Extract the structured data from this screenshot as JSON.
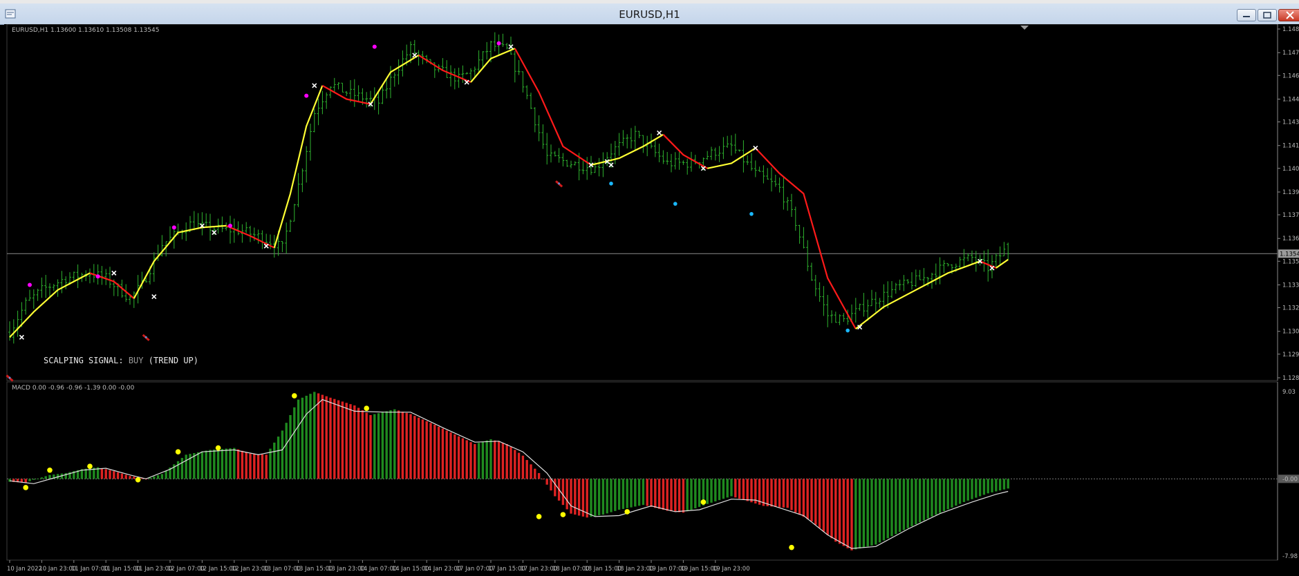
{
  "window": {
    "title": "EURUSD,H1",
    "controls": [
      "minimize",
      "restore",
      "close"
    ]
  },
  "main_info": "EURUSD,H1  1.13600 1.13610 1.13508 1.13545",
  "signal": {
    "prefix": "SCALPING SIGNAL:",
    "value": "BUY",
    "suffix": "(TREND UP)"
  },
  "macd_info": "MACD 0.00 -0.96 -0.96 -1.39 0.00 -0.00",
  "colors": {
    "background": "#000000",
    "candle": "#2fb52f",
    "ma_up": "#ffff33",
    "ma_down": "#ff1a1a",
    "hist_up": "#1f8a1f",
    "hist_down": "#dd2222",
    "macd_signal": "#e0e0e0",
    "macd_marker": "#ffff00",
    "swing_marker": "#ffffff",
    "buy_arrow": "#ff00ff",
    "dot_marker": "#1ab8ff",
    "current_price_bg": "#9b9b9b"
  },
  "chart_data": [
    {
      "type": "candlestick",
      "symbol": "EURUSD",
      "timeframe": "H1",
      "last_bar": {
        "open": 1.136,
        "high": 1.1361,
        "low": 1.13508,
        "close": 1.13545
      },
      "current_price_label": "1.13545",
      "y_ticks": [
        "1.14875",
        "1.14735",
        "1.14600",
        "1.14460",
        "1.14325",
        "1.14185",
        "1.14050",
        "1.13910",
        "1.13775",
        "1.13635",
        "1.13500",
        "1.13360",
        "1.13225",
        "1.13085",
        "1.12950",
        "1.12810"
      ],
      "ylim": [
        1.1281,
        1.14875
      ],
      "x_ticks": [
        "10 Jan 2022",
        "10 Jan 23:00",
        "11 Jan 07:00",
        "11 Jan 15:00",
        "11 Jan 23:00",
        "12 Jan 07:00",
        "12 Jan 15:00",
        "12 Jan 23:00",
        "13 Jan 07:00",
        "13 Jan 15:00",
        "13 Jan 23:00",
        "14 Jan 07:00",
        "14 Jan 15:00",
        "14 Jan 23:00",
        "17 Jan 07:00",
        "17 Jan 15:00",
        "17 Jan 23:00",
        "18 Jan 07:00",
        "18 Jan 15:00",
        "18 Jan 23:00",
        "19 Jan 07:00",
        "19 Jan 15:00",
        "19 Jan 23:00"
      ],
      "close_path": [
        [
          0,
          1.1308
        ],
        [
          4,
          1.1325
        ],
        [
          8,
          1.1333
        ],
        [
          14,
          1.134
        ],
        [
          20,
          1.1343
        ],
        [
          24,
          1.134
        ],
        [
          30,
          1.1328
        ],
        [
          33,
          1.1336
        ],
        [
          38,
          1.136
        ],
        [
          45,
          1.1372
        ],
        [
          52,
          1.1369
        ],
        [
          58,
          1.1368
        ],
        [
          64,
          1.1363
        ],
        [
          68,
          1.1358
        ],
        [
          72,
          1.1395
        ],
        [
          76,
          1.1438
        ],
        [
          80,
          1.1455
        ],
        [
          84,
          1.145
        ],
        [
          92,
          1.1444
        ],
        [
          96,
          1.1462
        ],
        [
          100,
          1.1476
        ],
        [
          105,
          1.1465
        ],
        [
          112,
          1.1458
        ],
        [
          115,
          1.1462
        ],
        [
          120,
          1.1478
        ],
        [
          124,
          1.1475
        ],
        [
          128,
          1.1455
        ],
        [
          134,
          1.1412
        ],
        [
          140,
          1.1408
        ],
        [
          146,
          1.1405
        ],
        [
          150,
          1.1415
        ],
        [
          156,
          1.1425
        ],
        [
          158,
          1.142
        ],
        [
          164,
          1.1408
        ],
        [
          170,
          1.1408
        ],
        [
          176,
          1.1415
        ],
        [
          180,
          1.1418
        ],
        [
          186,
          1.1402
        ],
        [
          192,
          1.1393
        ],
        [
          196,
          1.1373
        ],
        [
          200,
          1.134
        ],
        [
          204,
          1.1318
        ],
        [
          208,
          1.1315
        ],
        [
          214,
          1.1325
        ],
        [
          222,
          1.1335
        ],
        [
          228,
          1.134
        ],
        [
          234,
          1.1348
        ],
        [
          240,
          1.1352
        ],
        [
          244,
          1.1346
        ],
        [
          248,
          1.1356
        ]
      ],
      "ma_segments": [
        {
          "trend": "up",
          "points": [
            [
              0,
              1.1305
            ],
            [
              6,
              1.132
            ],
            [
              12,
              1.1333
            ],
            [
              20,
              1.1343
            ]
          ]
        },
        {
          "trend": "down",
          "points": [
            [
              20,
              1.1343
            ],
            [
              26,
              1.1338
            ],
            [
              31,
              1.1328
            ]
          ]
        },
        {
          "trend": "up",
          "points": [
            [
              31,
              1.1328
            ],
            [
              36,
              1.135
            ],
            [
              42,
              1.1367
            ],
            [
              48,
              1.137
            ],
            [
              54,
              1.1371
            ]
          ]
        },
        {
          "trend": "down",
          "points": [
            [
              54,
              1.1371
            ],
            [
              60,
              1.1365
            ],
            [
              66,
              1.1358
            ]
          ]
        },
        {
          "trend": "up",
          "points": [
            [
              66,
              1.1358
            ],
            [
              70,
              1.139
            ],
            [
              74,
              1.143
            ],
            [
              78,
              1.1454
            ]
          ]
        },
        {
          "trend": "down",
          "points": [
            [
              78,
              1.1454
            ],
            [
              84,
              1.1446
            ],
            [
              90,
              1.1443
            ]
          ]
        },
        {
          "trend": "up",
          "points": [
            [
              90,
              1.1443
            ],
            [
              95,
              1.1462
            ],
            [
              102,
              1.1472
            ]
          ]
        },
        {
          "trend": "down",
          "points": [
            [
              102,
              1.1472
            ],
            [
              108,
              1.1463
            ],
            [
              115,
              1.1456
            ]
          ]
        },
        {
          "trend": "up",
          "points": [
            [
              115,
              1.1456
            ],
            [
              120,
              1.147
            ],
            [
              126,
              1.1476
            ]
          ]
        },
        {
          "trend": "down",
          "points": [
            [
              126,
              1.1476
            ],
            [
              132,
              1.145
            ],
            [
              138,
              1.1418
            ],
            [
              145,
              1.1407
            ]
          ]
        },
        {
          "trend": "up",
          "points": [
            [
              145,
              1.1407
            ],
            [
              152,
              1.1411
            ],
            [
              158,
              1.1418
            ],
            [
              163,
              1.1425
            ]
          ]
        },
        {
          "trend": "down",
          "points": [
            [
              163,
              1.1425
            ],
            [
              168,
              1.1413
            ],
            [
              174,
              1.1405
            ]
          ]
        },
        {
          "trend": "up",
          "points": [
            [
              174,
              1.1405
            ],
            [
              180,
              1.1408
            ],
            [
              186,
              1.1417
            ]
          ]
        },
        {
          "trend": "down",
          "points": [
            [
              186,
              1.1417
            ],
            [
              192,
              1.1402
            ],
            [
              198,
              1.139
            ],
            [
              204,
              1.134
            ],
            [
              211,
              1.131
            ]
          ]
        },
        {
          "trend": "up",
          "points": [
            [
              211,
              1.131
            ],
            [
              218,
              1.1323
            ],
            [
              226,
              1.1333
            ],
            [
              234,
              1.1343
            ],
            [
              242,
              1.135
            ]
          ]
        },
        {
          "trend": "down",
          "points": [
            [
              242,
              1.135
            ],
            [
              246,
              1.1346
            ]
          ]
        },
        {
          "trend": "up",
          "points": [
            [
              246,
              1.1346
            ],
            [
              249,
              1.1351
            ]
          ]
        }
      ],
      "swing_points": [
        [
          3,
          1.1305
        ],
        [
          26,
          1.1343
        ],
        [
          36,
          1.1329
        ],
        [
          48,
          1.1371
        ],
        [
          51,
          1.1367
        ],
        [
          64,
          1.1359
        ],
        [
          76,
          1.1454
        ],
        [
          90,
          1.1443
        ],
        [
          101,
          1.1472
        ],
        [
          114,
          1.1456
        ],
        [
          125,
          1.1477
        ],
        [
          145,
          1.1407
        ],
        [
          149,
          1.1409
        ],
        [
          150,
          1.1407
        ],
        [
          162,
          1.1426
        ],
        [
          173,
          1.1405
        ],
        [
          186,
          1.1417
        ],
        [
          212,
          1.1311
        ],
        [
          242,
          1.135
        ],
        [
          245,
          1.1346
        ]
      ],
      "buy_arrows": [
        [
          5,
          1.1336
        ],
        [
          22,
          1.1341
        ],
        [
          41,
          1.137
        ],
        [
          55,
          1.1371
        ],
        [
          74,
          1.1448
        ],
        [
          91,
          1.1477
        ],
        [
          122,
          1.1479
        ]
      ],
      "sell_markers": [
        [
          0,
          1.1281
        ],
        [
          34,
          1.1305
        ],
        [
          137,
          1.1396
        ]
      ],
      "blue_dots": [
        [
          150,
          1.1396
        ],
        [
          166,
          1.1384
        ],
        [
          185,
          1.1378
        ],
        [
          209,
          1.1309
        ]
      ]
    },
    {
      "type": "histogram",
      "name": "MACD",
      "info": "MACD 0.00 -0.96 -0.96 -1.39 0.00 -0.00",
      "y_ticks": [
        "9.03",
        "-0.00",
        "-7.98"
      ],
      "ylim": [
        -7.98,
        9.03
      ],
      "zero_label": "-0.00",
      "hist_path": [
        [
          0,
          -0.3
        ],
        [
          4,
          -0.4
        ],
        [
          6,
          -0.1
        ],
        [
          10,
          0.4
        ],
        [
          14,
          0.6
        ],
        [
          18,
          1.0
        ],
        [
          22,
          1.2
        ],
        [
          26,
          0.8
        ],
        [
          30,
          0.3
        ],
        [
          34,
          0.0
        ],
        [
          38,
          0.5
        ],
        [
          44,
          2.5
        ],
        [
          50,
          3.0
        ],
        [
          56,
          3.2
        ],
        [
          60,
          2.6
        ],
        [
          64,
          2.5
        ],
        [
          68,
          5.0
        ],
        [
          72,
          8.2
        ],
        [
          76,
          9.0
        ],
        [
          80,
          8.4
        ],
        [
          86,
          7.6
        ],
        [
          90,
          6.6
        ],
        [
          96,
          7.2
        ],
        [
          100,
          6.7
        ],
        [
          106,
          5.6
        ],
        [
          112,
          4.4
        ],
        [
          116,
          3.6
        ],
        [
          120,
          4.1
        ],
        [
          124,
          3.6
        ],
        [
          128,
          2.4
        ],
        [
          132,
          0.6
        ],
        [
          136,
          -1.8
        ],
        [
          140,
          -3.6
        ],
        [
          144,
          -4.0
        ],
        [
          148,
          -3.7
        ],
        [
          152,
          -3.2
        ],
        [
          158,
          -2.7
        ],
        [
          164,
          -3.3
        ],
        [
          168,
          -3.5
        ],
        [
          174,
          -2.6
        ],
        [
          180,
          -1.8
        ],
        [
          184,
          -2.3
        ],
        [
          188,
          -2.8
        ],
        [
          194,
          -3.0
        ],
        [
          200,
          -4.4
        ],
        [
          206,
          -6.5
        ],
        [
          210,
          -7.4
        ],
        [
          216,
          -6.8
        ],
        [
          222,
          -5.5
        ],
        [
          230,
          -3.9
        ],
        [
          238,
          -2.4
        ],
        [
          244,
          -1.5
        ],
        [
          249,
          -1.0
        ]
      ],
      "signal_path": [
        [
          0,
          -0.2
        ],
        [
          6,
          -0.5
        ],
        [
          12,
          0.2
        ],
        [
          18,
          0.9
        ],
        [
          24,
          1.1
        ],
        [
          30,
          0.4
        ],
        [
          34,
          0.0
        ],
        [
          40,
          1.0
        ],
        [
          48,
          2.8
        ],
        [
          56,
          3.0
        ],
        [
          62,
          2.5
        ],
        [
          68,
          3.0
        ],
        [
          74,
          6.7
        ],
        [
          78,
          8.2
        ],
        [
          86,
          7.0
        ],
        [
          94,
          6.9
        ],
        [
          100,
          6.9
        ],
        [
          108,
          5.3
        ],
        [
          116,
          3.8
        ],
        [
          122,
          3.9
        ],
        [
          128,
          2.8
        ],
        [
          134,
          0.6
        ],
        [
          140,
          -2.8
        ],
        [
          146,
          -3.9
        ],
        [
          152,
          -3.8
        ],
        [
          160,
          -2.8
        ],
        [
          166,
          -3.4
        ],
        [
          172,
          -3.2
        ],
        [
          180,
          -2.1
        ],
        [
          186,
          -2.2
        ],
        [
          192,
          -3.0
        ],
        [
          198,
          -3.8
        ],
        [
          204,
          -5.8
        ],
        [
          210,
          -7.2
        ],
        [
          216,
          -7.0
        ],
        [
          224,
          -5.2
        ],
        [
          232,
          -3.6
        ],
        [
          240,
          -2.4
        ],
        [
          246,
          -1.6
        ],
        [
          249,
          -1.3
        ]
      ],
      "peak_markers": [
        [
          4,
          -0.9
        ],
        [
          10,
          0.9
        ],
        [
          20,
          1.3
        ],
        [
          32,
          -0.1
        ],
        [
          42,
          2.8
        ],
        [
          52,
          3.2
        ],
        [
          71,
          8.6
        ],
        [
          89,
          7.3
        ],
        [
          132,
          -3.9
        ],
        [
          138,
          -3.7
        ],
        [
          154,
          -3.4
        ],
        [
          173,
          -2.4
        ],
        [
          195,
          -7.1
        ]
      ]
    }
  ]
}
